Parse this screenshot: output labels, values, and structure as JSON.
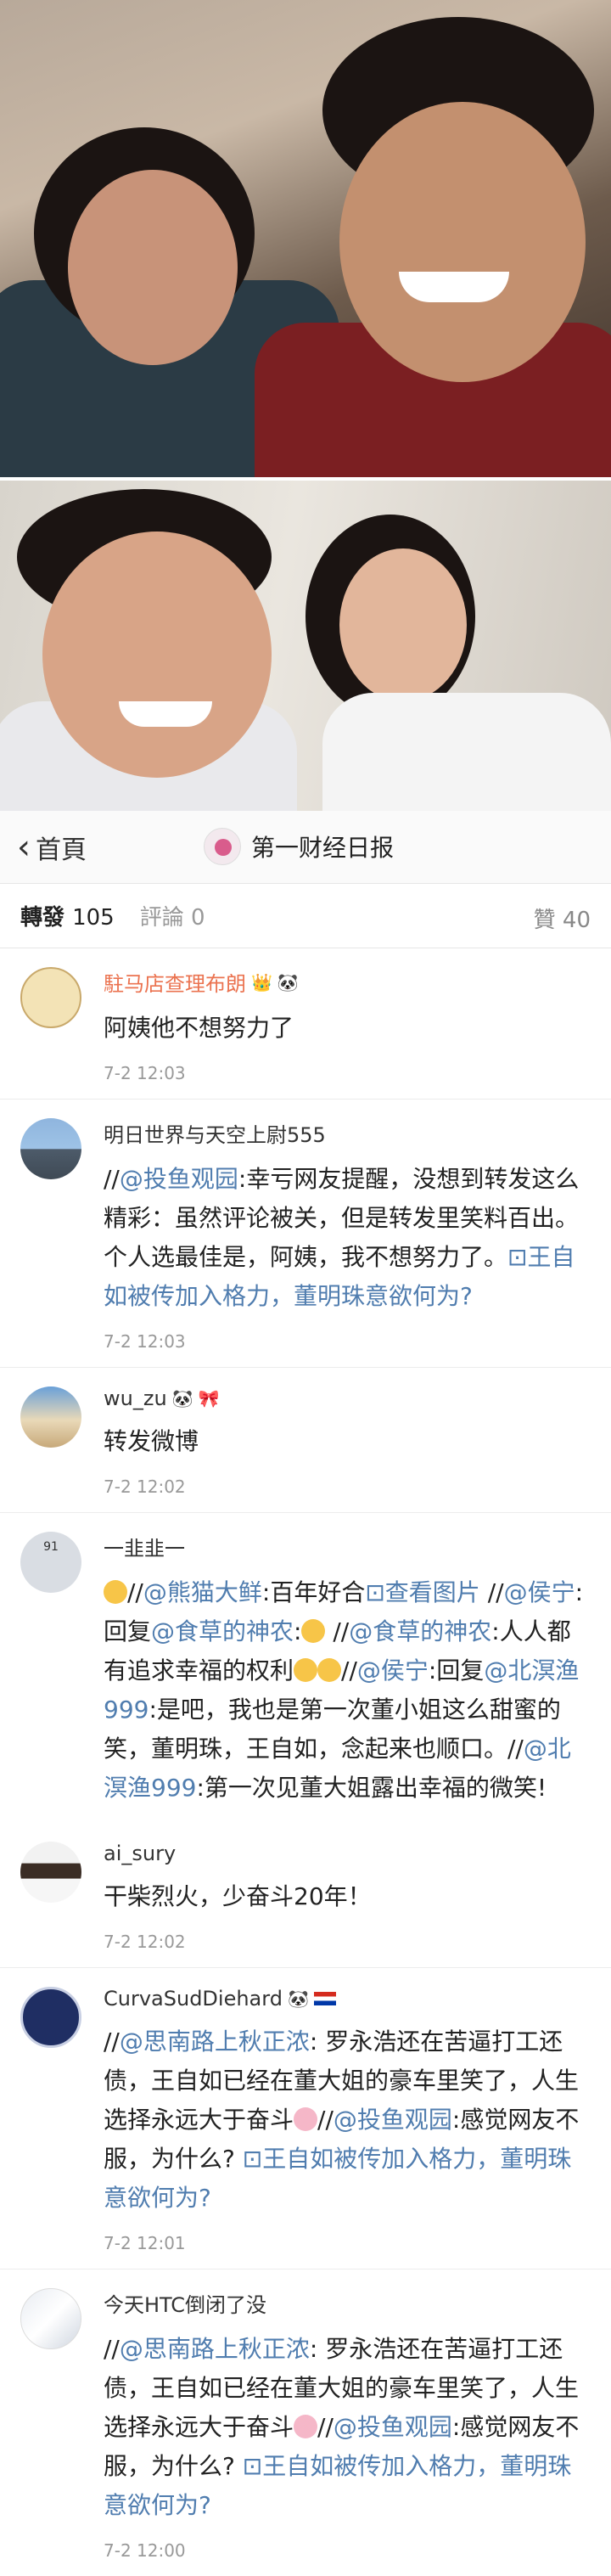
{
  "nav": {
    "back_label": "首頁",
    "title": "第一财经日报"
  },
  "tabs": [
    {
      "label": "轉發",
      "count": "105"
    },
    {
      "label": "評論",
      "count": "0"
    }
  ],
  "likes": {
    "label": "贊",
    "count": "40"
  },
  "comments": [
    {
      "name": "駐马店查理布朗",
      "text": "阿姨他不想努力了",
      "time": "7-2 12:03"
    },
    {
      "name": "明日世界与天空上尉555",
      "text_parts": [
        "//",
        "@投鱼观园",
        ":幸亏网友提醒，没想到转发这么精彩：虽然评论被关，但是转发里笑料百出。个人选最佳是，阿姨，我不想努力了。",
        "⊡王自如被传加入格力，董明珠意欲何为?"
      ],
      "time": "7-2 12:03"
    },
    {
      "name": "wu_zu",
      "text": "转发微博",
      "time": "7-2 12:02"
    },
    {
      "name": "一韭韭一",
      "text_parts": [
        "//",
        "@熊猫大鲜",
        ":百年好合",
        "⊡查看图片",
        "//",
        "@侯宁",
        ":回复",
        "@食草的神农",
        ":",
        "//",
        "@食草的神农",
        ":人人都有追求幸福的权利",
        "//",
        "@侯宁",
        ":回复",
        "@北溟渔999",
        ":是吧，我也是第一次董小姐这么甜蜜的笑，董明珠，王自如，念起来也顺口。//",
        "@北溟渔999",
        ":第一次见董大姐露出幸福的微笑!"
      ],
      "avatar_text": "91"
    },
    {
      "name": "ai_sury",
      "text": "干柴烈火，少奋斗20年！",
      "time": "7-2 12:02"
    },
    {
      "name": "CurvaSudDiehard",
      "text_parts": [
        "//",
        "@思南路上秋正浓",
        ": 罗永浩还在苦逼打工还债，王自如已经在董大姐的豪车里笑了，人生选择永远大于奋斗",
        "//",
        "@投鱼观园",
        ":感觉网友不服，为什么?",
        "⊡王自如被传加入格力，董明珠意欲何为?"
      ],
      "time": "7-2 12:01"
    },
    {
      "name": "今天HTC倒闭了没",
      "text_parts": [
        "//",
        "@思南路上秋正浓",
        ": 罗永浩还在苦逼打工还债，王自如已经在董大姐的豪车里笑了，人生选择永远大于奋斗",
        "//",
        "@投鱼观园",
        ":感觉网友不服，为什么?",
        "⊡王自如被传加入格力，董明珠意欲何为?"
      ],
      "time": "7-2 12:00"
    }
  ],
  "colors": {
    "link": "#507daf",
    "highlight_name": "#eb7350",
    "muted": "#999999"
  }
}
